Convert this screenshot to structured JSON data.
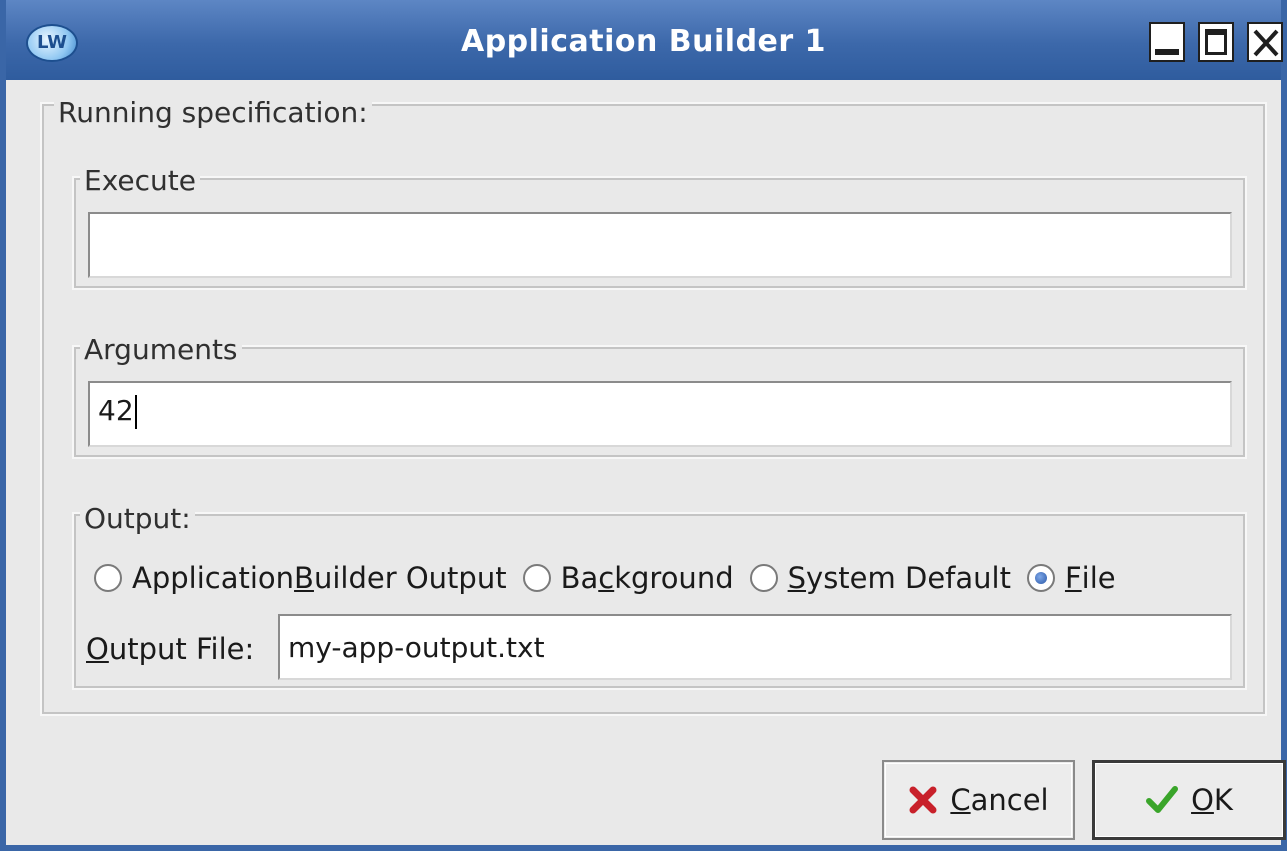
{
  "window": {
    "title": "Application Builder 1",
    "icon_text": "LW",
    "controls": [
      "minimize-icon",
      "maximize-icon",
      "close-icon"
    ]
  },
  "running_spec": {
    "label": "Running specification:",
    "execute": {
      "label": "Execute",
      "value": ""
    },
    "arguments": {
      "label": "Arguments",
      "value": "42"
    },
    "output": {
      "label": "Output:",
      "options": [
        {
          "pre": "Application ",
          "accel": "B",
          "post": "uilder Output",
          "checked": false
        },
        {
          "pre": "Ba",
          "accel": "c",
          "post": "kground",
          "checked": false
        },
        {
          "pre": "",
          "accel": "S",
          "post": "ystem Default",
          "checked": false
        },
        {
          "pre": "",
          "accel": "F",
          "post": "ile",
          "checked": true
        }
      ],
      "output_file": {
        "label_accel": "O",
        "label_rest": "utput File:",
        "value": "my-app-output.txt"
      }
    }
  },
  "buttons": {
    "cancel": {
      "accel": "C",
      "rest": "ancel",
      "icon": "x-icon",
      "color": "#c8202a"
    },
    "ok": {
      "accel": "O",
      "rest": "K",
      "icon": "checkmark-icon",
      "color": "#3aa52a"
    }
  },
  "colors": {
    "titlebar": "#3c68aa",
    "window_bg": "#e9e9e9"
  }
}
